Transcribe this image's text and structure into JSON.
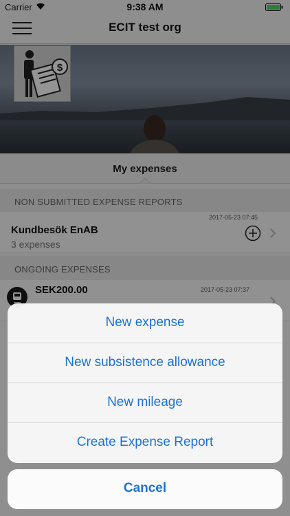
{
  "status_bar": {
    "carrier": "Carrier",
    "time": "9:38 AM"
  },
  "nav": {
    "title": "ECIT test org"
  },
  "tabs": {
    "active": "My expenses"
  },
  "sections": {
    "non_submitted": {
      "header": "NON SUBMITTED EXPENSE REPORTS",
      "items": [
        {
          "title": "Kundbesök EnAB",
          "subtitle": "3 expenses",
          "timestamp": "2017-05-23 07:45"
        }
      ]
    },
    "ongoing": {
      "header": "ONGOING EXPENSES",
      "items": [
        {
          "amount": "SEK200.00",
          "timestamp": "2017-05-23 07:37"
        }
      ]
    }
  },
  "action_sheet": {
    "options": [
      "New expense",
      "New subsistence allowance",
      "New mileage",
      "Create Expense Report"
    ],
    "cancel": "Cancel"
  },
  "colors": {
    "accent": "#1a73d9",
    "battery": "#4cd964"
  }
}
